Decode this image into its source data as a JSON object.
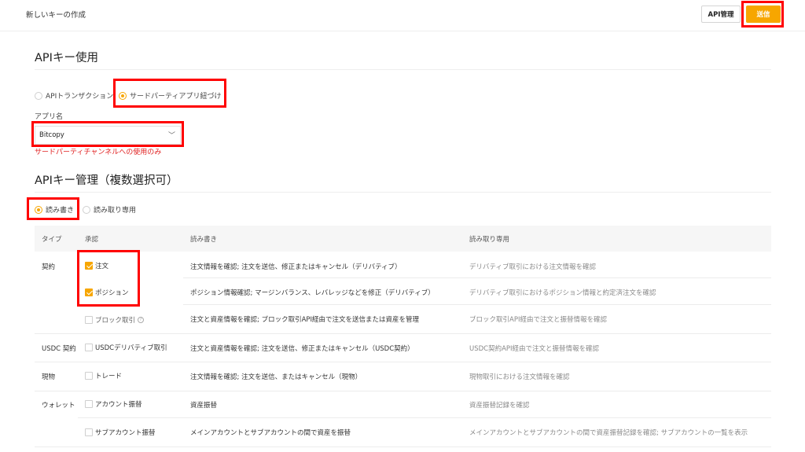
{
  "header": {
    "title": "新しいキーの作成",
    "api_manage_label": "API管理",
    "submit_label": "送信"
  },
  "colors": {
    "accent": "#f7a600",
    "highlight": "#ff0000",
    "note": "#e02020"
  },
  "usage": {
    "title": "APIキー使用",
    "options": [
      "APIトランザクション",
      "サードパーティアプリ紐づけ"
    ],
    "selected": "サードパーティアプリ紐づけ",
    "app_label": "アプリ名",
    "app_value": "Bitcopy",
    "note": "サードパーティチャンネルへの使用のみ"
  },
  "manage": {
    "title": "APIキー管理（複数選択可）",
    "modes": [
      "読み書き",
      "読み取り専用"
    ],
    "selected_mode": "読み書き"
  },
  "table": {
    "headers": [
      "タイプ",
      "承認",
      "読み書き",
      "読み取り専用"
    ],
    "rows": [
      {
        "type": "契約",
        "perm": "注文",
        "checked": true,
        "rw": "注文情報を確認; 注文を送信、修正またはキャンセル（デリバティブ）",
        "ro": "デリバティブ取引における注文情報を確認"
      },
      {
        "type": "",
        "perm": "ポジション",
        "checked": true,
        "rw": "ポジション情報確認; マージンバランス、レバレッジなどを修正（デリバティブ）",
        "ro": "デリバティブ取引におけるポジション情報と約定済注文を確認"
      },
      {
        "type": "",
        "perm": "ブロック取引",
        "checked": false,
        "help": "?",
        "rw": "注文と資産情報を確認; ブロック取引API経由で注文を送信または資産を管理",
        "ro": "ブロック取引API経由で注文と振替情報を確認"
      },
      {
        "type": "USDC 契約",
        "perm": "USDCデリバティブ取引",
        "checked": false,
        "rw": "注文と資産情報を確認; 注文を送信、修正またはキャンセル（USDC契約）",
        "ro": "USDC契約API経由で注文と振替情報を確認"
      },
      {
        "type": "現物",
        "perm": "トレード",
        "checked": false,
        "rw": "注文情報を確認; 注文を送信、またはキャンセル（現物）",
        "ro": "現物取引における注文情報を確認"
      },
      {
        "type": "ウォレット",
        "perm": "アカウント振替",
        "checked": false,
        "rw": "資産振替",
        "ro": "資産振替記録を確認"
      },
      {
        "type": "",
        "perm": "サブアカウント振替",
        "checked": false,
        "rw": "メインアカウントとサブアカウントの間で資産を振替",
        "ro": "メインアカウントとサブアカウントの間で資産振替記録を確認; サブアカウントの一覧を表示"
      }
    ]
  }
}
